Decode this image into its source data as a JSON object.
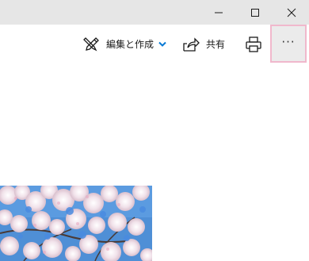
{
  "window_controls": {
    "minimize_icon": "minimize-icon",
    "maximize_icon": "maximize-icon",
    "close_icon": "close-icon"
  },
  "toolbar": {
    "edit_create_label": "編集と作成",
    "edit_icon": "pen-pencil-icon",
    "edit_dropdown_icon": "chevron-down-icon",
    "share_label": "共有",
    "share_icon": "share-icon",
    "print_icon": "printer-icon",
    "more_label": "···",
    "accent_color": "#0078d4",
    "more_highlight_color": "#f0b8cc"
  },
  "photo": {
    "subject": "cherry-blossoms-image"
  }
}
